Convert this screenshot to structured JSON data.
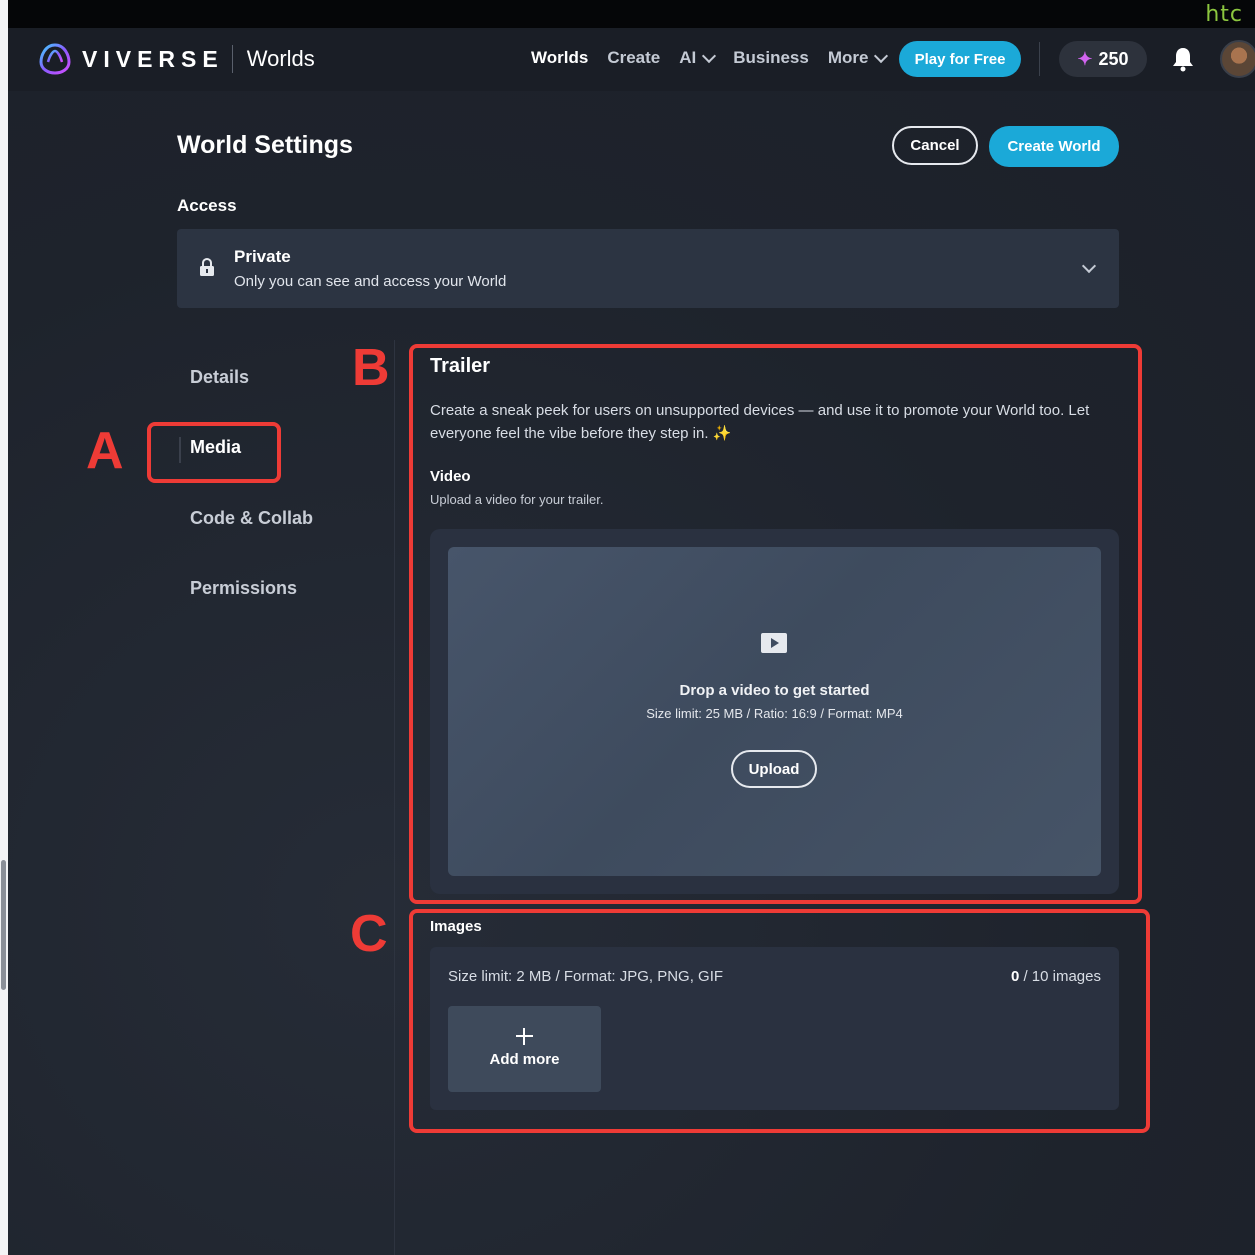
{
  "system": {
    "htc_logo": "htc"
  },
  "header": {
    "brand": "VIVERSE",
    "section": "Worlds",
    "nav": [
      {
        "label": "Worlds",
        "active": true,
        "dropdown": false
      },
      {
        "label": "Create",
        "active": false,
        "dropdown": false
      },
      {
        "label": "AI",
        "active": false,
        "dropdown": true
      },
      {
        "label": "Business",
        "active": false,
        "dropdown": false
      },
      {
        "label": "More",
        "active": false,
        "dropdown": true
      }
    ],
    "play_button": "Play for Free",
    "credits": "250",
    "icons": {
      "credits": "sparkle-icon",
      "notifications": "bell-icon",
      "profile": "avatar"
    }
  },
  "page": {
    "title": "World Settings",
    "cancel_label": "Cancel",
    "create_label": "Create World",
    "access": {
      "label": "Access",
      "value_title": "Private",
      "value_desc": "Only you can see and access your World",
      "icon": "lock-icon"
    }
  },
  "sidebar": {
    "items": [
      {
        "label": "Details",
        "active": false
      },
      {
        "label": "Media",
        "active": true
      },
      {
        "label": "Code & Collab",
        "active": false
      },
      {
        "label": "Permissions",
        "active": false
      }
    ]
  },
  "trailer": {
    "title": "Trailer",
    "description": "Create a sneak peek for users on unsupported devices — and use it to promote your World too. Let everyone feel the vibe before they step in. ✨",
    "video_label": "Video",
    "video_desc": "Upload a video for your trailer.",
    "drop_title": "Drop a video to get started",
    "drop_limits": "Size limit: 25 MB / Ratio: 16:9 / Format: MP4",
    "upload_label": "Upload"
  },
  "images": {
    "label": "Images",
    "limit": "Size limit: 2 MB / Format: JPG, PNG, GIF",
    "count_current": "0",
    "count_total": " / 10 images",
    "add_more_label": "Add more"
  },
  "annotations": {
    "a": "A",
    "b": "B",
    "c": "C",
    "color": "#ee3b36"
  },
  "colors": {
    "accent": "#1ba9d8",
    "background": "#1e232d"
  }
}
